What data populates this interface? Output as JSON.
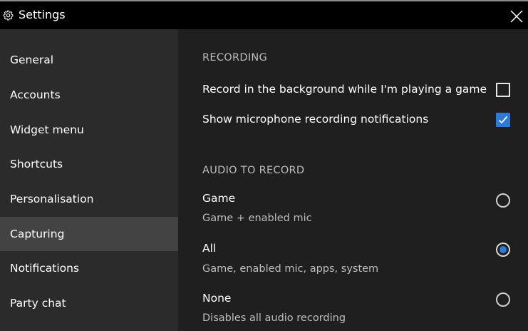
{
  "window": {
    "title": "Settings",
    "title_icon": "gear-icon",
    "close_icon": "close-icon"
  },
  "sidebar": {
    "items": [
      {
        "label": "General",
        "active": false
      },
      {
        "label": "Accounts",
        "active": false
      },
      {
        "label": "Widget menu",
        "active": false
      },
      {
        "label": "Shortcuts",
        "active": false
      },
      {
        "label": "Personalisation",
        "active": false
      },
      {
        "label": "Capturing",
        "active": true
      },
      {
        "label": "Notifications",
        "active": false
      },
      {
        "label": "Party chat",
        "active": false
      }
    ]
  },
  "recording": {
    "header": "RECORDING",
    "background_label": "Record in the background while I'm playing a game",
    "background_checked": false,
    "mic_notifications_label": "Show microphone recording notifications",
    "mic_notifications_checked": true
  },
  "audio": {
    "header": "AUDIO TO RECORD",
    "options": [
      {
        "title": "Game",
        "description": "Game + enabled mic",
        "selected": false
      },
      {
        "title": "All",
        "description": "Game, enabled mic, apps, system",
        "selected": true
      },
      {
        "title": "None",
        "description": "Disables all audio recording",
        "selected": false
      }
    ]
  },
  "colors": {
    "accent": "#2c7bd6",
    "titlebar": "#000000",
    "sidebar": "#2b2b2b",
    "sidebar_active": "#434343",
    "content": "#1f1f1f"
  }
}
